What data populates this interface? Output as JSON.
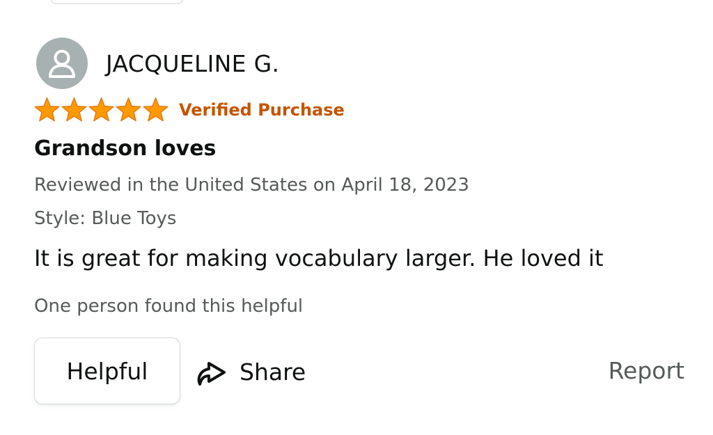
{
  "reviewer": {
    "name": "JACQUELINE G.",
    "avatar_icon": "user-silhouette-icon"
  },
  "rating": {
    "stars": 5,
    "max_stars": 5,
    "star_color": "#ff9900",
    "star_icon": "star-icon"
  },
  "badge": {
    "label": "Verified Purchase",
    "color": "#c45500"
  },
  "review": {
    "title": "Grandson loves",
    "date_line": "Reviewed in the United States on April 18, 2023",
    "style_line": "Style: Blue Toys",
    "body": "It is great for making vocabulary larger. He loved it",
    "helpful_count_text": "One person found this helpful"
  },
  "actions": {
    "helpful_label": "Helpful",
    "share_label": "Share",
    "share_icon": "share-arrow-icon",
    "report_label": "Report"
  }
}
